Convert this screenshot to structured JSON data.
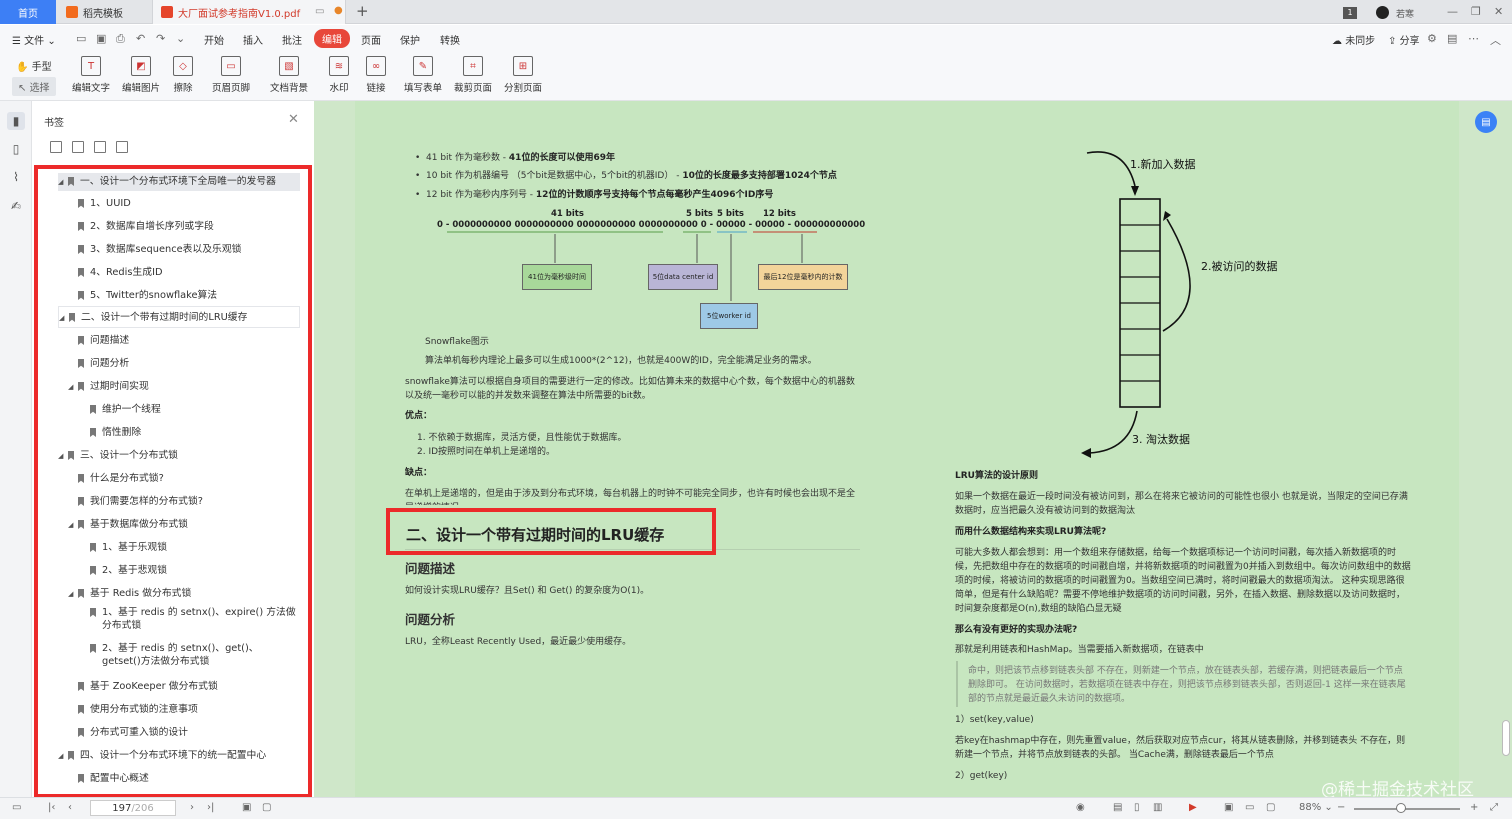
{
  "tabs": {
    "home": "首页",
    "template": "稻壳模板",
    "document": "大厂面试参考指南V1.0.pdf",
    "page_badge": "1",
    "user": "若寒"
  },
  "menu": {
    "file": "文件",
    "items": [
      "开始",
      "插入",
      "批注",
      "编辑",
      "页面",
      "保护",
      "转换"
    ],
    "sync": "未同步",
    "share": "分享"
  },
  "toolbar": {
    "hand": "手型",
    "select": "选择",
    "tools": [
      "编辑文字",
      "编辑图片",
      "擦除",
      "页眉页脚",
      "文档背景",
      "水印",
      "链接",
      "填写表单",
      "裁剪页面",
      "分割页面"
    ]
  },
  "bookmarks": {
    "title": "书签",
    "items": [
      "一、设计一个分布式环境下全局唯一的发号器",
      "1、UUID",
      "2、数据库自增长序列或字段",
      "3、数据库sequence表以及乐观锁",
      "4、Redis生成ID",
      "5、Twitter的snowflake算法",
      "二、设计一个带有过期时间的LRU缓存",
      "问题描述",
      "问题分析",
      "过期时间实现",
      "维护一个线程",
      "惰性删除",
      "三、设计一个分布式锁",
      "什么是分布式锁?",
      "我们需要怎样的分布式锁?",
      "基于数据库做分布式锁",
      "1、基于乐观锁",
      "2、基于悲观锁",
      "基于 Redis 做分布式锁",
      "1、基于 redis 的 setnx()、expire() 方法做分布式锁",
      "2、基于 redis 的 setnx()、get()、getset()方法做分布式锁",
      "基于 ZooKeeper 做分布式锁",
      "使用分布式锁的注意事项",
      "分布式可重入锁的设计",
      "四、设计一个分布式环境下的统一配置中心",
      "配置中心概述"
    ]
  },
  "doc_left": {
    "bullet1_a": "41 bit 作为毫秒数 - ",
    "bullet1_b": "41位的长度可以使用69年",
    "bullet2_a": "10 bit 作为机器编号 （5个bit是数据中心，5个bit的机器ID） - ",
    "bullet2_b": "10位的长度最多支持部署1024个节点",
    "bullet3_a": "12 bit 作为毫秒内序列号 - ",
    "bullet3_b": "12位的计数顺序号支持每个节点每毫秒产生4096个ID序号",
    "diag_41": "41 bits",
    "diag_5a": "5 bits",
    "diag_5b": "5 bits",
    "diag_12": "12 bits",
    "diag_bits": "0 - 0000000000 0000000000 0000000000 0000000000 0 - 00000 - 00000 - 000000000000",
    "box_ms": "41位为毫秒级时间",
    "box_dc": "5位data center id",
    "box_seq": "最后12位是毫秒内的计数",
    "box_worker": "5位worker id",
    "caption": "Snowflake图示",
    "p1": "算法单机每秒内理论上最多可以生成1000*(2^12)，也就是400W的ID，完全能满足业务的需求。",
    "p2": "snowflake算法可以根据自身项目的需要进行一定的修改。比如估算未来的数据中心个数，每个数据中心的机器数以及统一毫秒可以能的并发数来调整在算法中所需要的bit数。",
    "adv_title": "优点：",
    "adv1": "1. 不依赖于数据库，灵活方便，且性能优于数据库。",
    "adv2": "2. ID按照时间在单机上是递增的。",
    "dis_title": "缺点：",
    "dis1": "在单机上是递增的，但是由于涉及到分布式环境，每台机器上的时钟不可能完全同步，也许有时候也会出现不是全局递增的情况。",
    "h1": "二、设计一个带有过期时间的LRU缓存",
    "h2a": "问题描述",
    "p3": "如何设计实现LRU缓存？且Set() 和 Get() 的复杂度为O(1)。",
    "h2b": "问题分析",
    "p4": "LRU，全称Least Recently Used，最近最少使用缓存。"
  },
  "doc_right": {
    "lbl1": "1.新加入数据",
    "lbl2": "2.被访问的数据",
    "lbl3": "3. 淘汰数据",
    "t1": "LRU算法的设计原则",
    "p1": "如果一个数据在最近一段时间没有被访问到，那么在将来它被访问的可能性也很小 也就是说，当限定的空间已存满数据时，应当把最久没有被访问到的数据淘汰",
    "t2": "而用什么数据结构来实现LRU算法呢?",
    "p2": "可能大多数人都会想到：用一个数组来存储数据，给每一个数据项标记一个访问时间戳，每次插入新数据项的时候，先把数组中存在的数据项的时间戳自增，并将新数据项的时间戳置为0并插入到数组中。每次访问数组中的数据项的时候，将被访问的数据项的时间戳置为0。当数组空间已满时，将时间戳最大的数据项淘汰。 这种实现思路很简单，但是有什么缺陷呢？需要不停地维护数据项的访问时间戳，另外，在插入数据、删除数据以及访问数据时，时间复杂度都是O(n),数组的缺陷凸显无疑",
    "t3": "那么有没有更好的实现办法呢?",
    "p3": "那就是利用链表和HashMap。当需要插入新数据项，在链表中",
    "quote": "命中，则把该节点移到链表头部 不存在，则新建一个节点，放在链表头部，若缓存满，则把链表最后一个节点删除即可。 在访问数据时，若数据项在链表中存在，则把该节点移到链表头部，否则返回-1 这样一来在链表尾部的节点就是最近最久未访问的数据项。",
    "s1": "1）set(key,value)",
    "p4": "若key在hashmap中存在，则先重置value，然后获取对应节点cur，将其从链表删除，并移到链表头 不存在，则新建一个节点，并将节点放到链表的头部。 当Cache满，删除链表最后一个节点",
    "s2": "2）get(key)"
  },
  "watermark": "@稀土掘金技术社区",
  "status": {
    "page_current": "197",
    "page_total": "/206",
    "zoom": "88%"
  },
  "colors": {
    "accent": "#3d7ff5",
    "active_menu": "#e8473a",
    "annotation_frame": "#ec2a2a",
    "doc_bg": "#c7e6c0"
  }
}
